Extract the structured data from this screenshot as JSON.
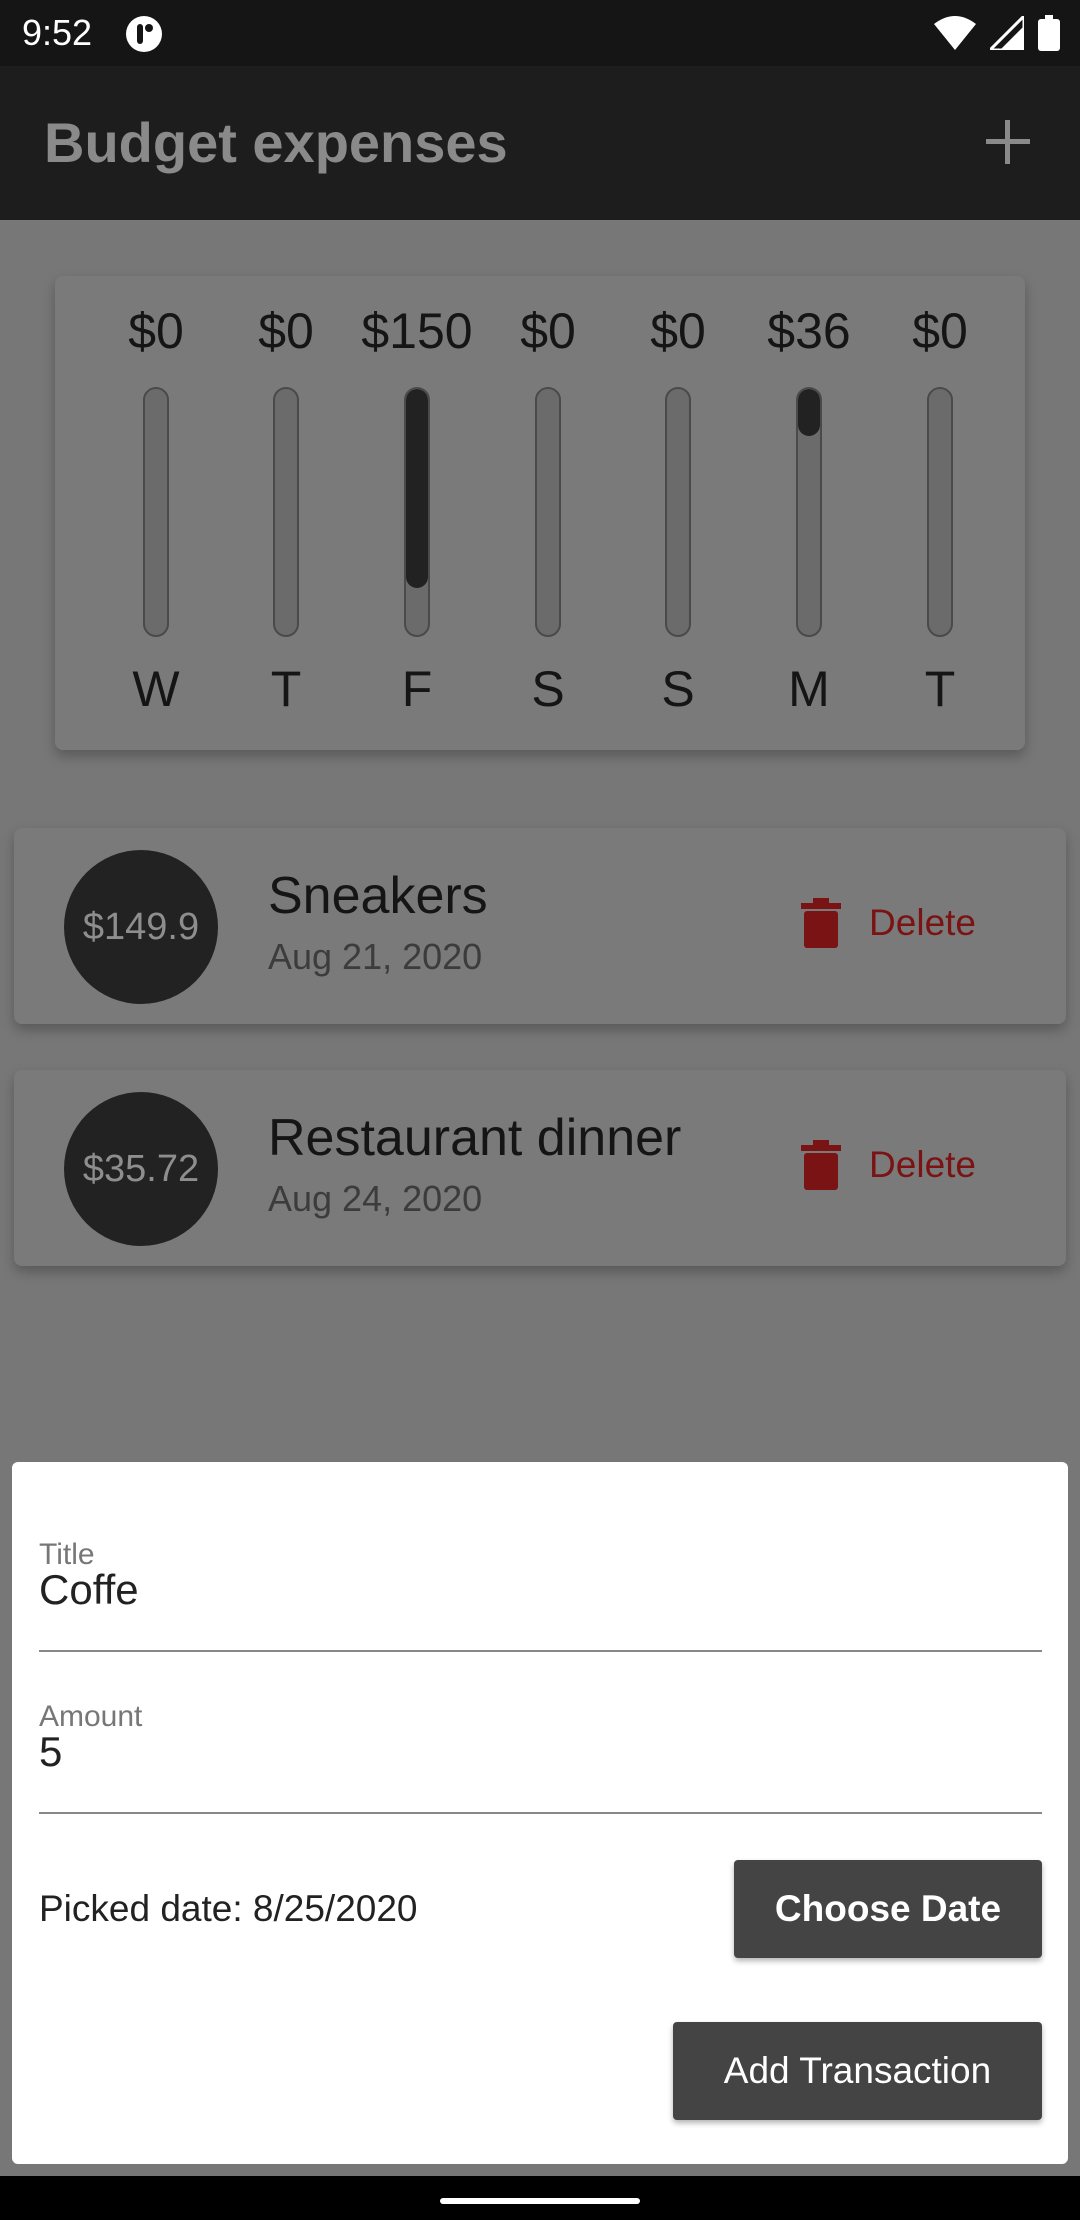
{
  "status_bar": {
    "time": "9:52"
  },
  "app_bar": {
    "title": "Budget expenses",
    "add_icon": "plus-icon"
  },
  "chart": {
    "bars": [
      {
        "day": "W",
        "amount_label": "$0",
        "pct": 0
      },
      {
        "day": "T",
        "amount_label": "$0",
        "pct": 0
      },
      {
        "day": "F",
        "amount_label": "$150",
        "pct": 0.81
      },
      {
        "day": "S",
        "amount_label": "$0",
        "pct": 0
      },
      {
        "day": "S",
        "amount_label": "$0",
        "pct": 0
      },
      {
        "day": "M",
        "amount_label": "$36",
        "pct": 0.19
      },
      {
        "day": "T",
        "amount_label": "$0",
        "pct": 0
      }
    ],
    "bar_color": "#222222",
    "track_color": "#6b6b6b"
  },
  "transactions": [
    {
      "amount": "$149.9",
      "title": "Sneakers",
      "date": "Aug 21, 2020",
      "delete_label": "Delete"
    },
    {
      "amount": "$35.72",
      "title": "Restaurant dinner",
      "date": "Aug 24, 2020",
      "delete_label": "Delete"
    }
  ],
  "form": {
    "title_label": "Title",
    "title_value": "Coffe",
    "amount_label": "Amount",
    "amount_value": "5",
    "picked_date": "Picked date: 8/25/2020",
    "choose_date_label": "Choose Date",
    "add_transaction_label": "Add Transaction"
  },
  "colors": {
    "delete": "#7a1313",
    "button": "#444444"
  }
}
